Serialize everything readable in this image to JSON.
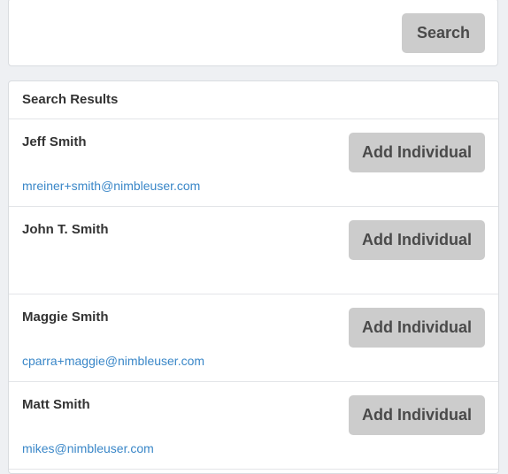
{
  "search": {
    "button_label": "Search"
  },
  "results": {
    "heading": "Search Results",
    "items": [
      {
        "name": "Jeff Smith",
        "email": "mreiner+smith@nimbleuser.com",
        "button_label": "Add Individual"
      },
      {
        "name": "John T. Smith",
        "email": "",
        "button_label": "Add Individual"
      },
      {
        "name": "Maggie Smith",
        "email": "cparra+maggie@nimbleuser.com",
        "button_label": "Add Individual"
      },
      {
        "name": "Matt Smith",
        "email": "mikes@nimbleuser.com",
        "button_label": "Add Individual"
      }
    ]
  },
  "colors": {
    "page_background": "#eef0f3",
    "button_background": "#cccccc",
    "link": "#3a87c8"
  }
}
